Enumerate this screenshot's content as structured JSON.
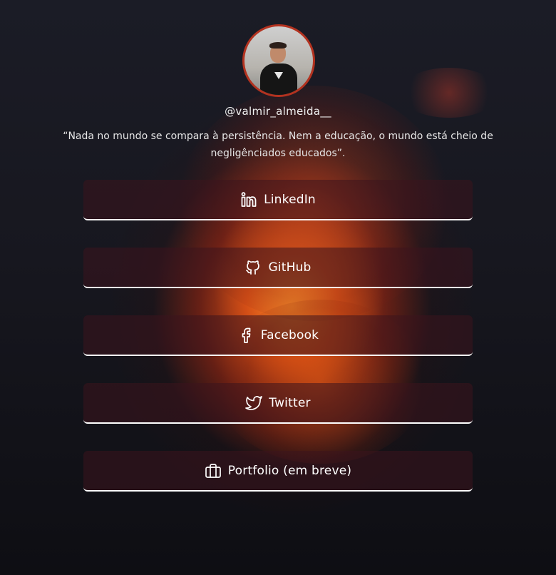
{
  "profile": {
    "username": "@valmir_almeida__",
    "quote": "“Nada no mundo se compara à persistência. Nem a educação, o mundo está cheio de negligênciados educados”."
  },
  "links": [
    {
      "label": "LinkedIn",
      "icon": "linkedin-icon"
    },
    {
      "label": "GitHub",
      "icon": "github-icon"
    },
    {
      "label": "Facebook",
      "icon": "facebook-icon"
    },
    {
      "label": "Twitter",
      "icon": "twitter-icon"
    },
    {
      "label": "Portfolio (em breve)",
      "icon": "briefcase-icon"
    }
  ],
  "colors": {
    "avatar_border": "#b3321f",
    "button_underline": "#ffffff",
    "background": "#17171f"
  }
}
